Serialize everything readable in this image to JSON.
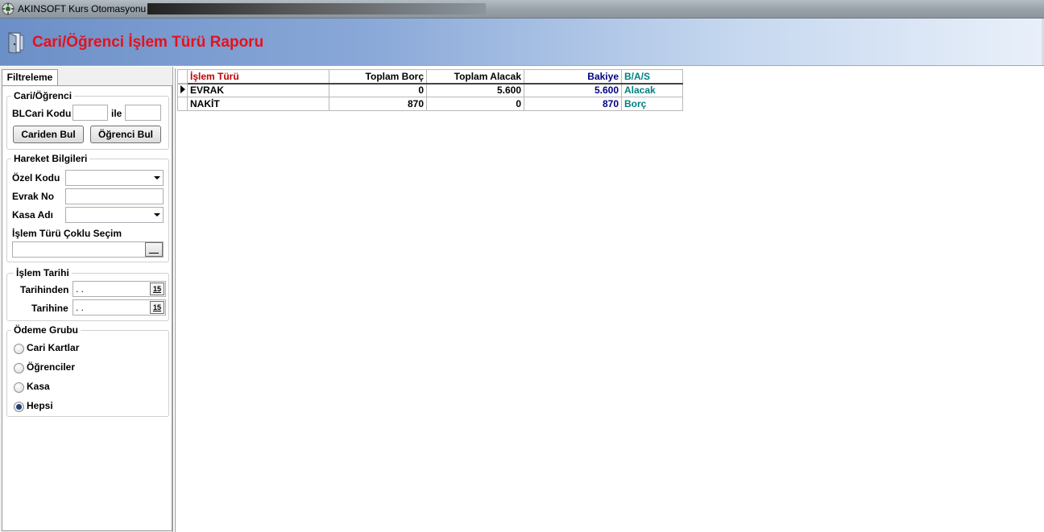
{
  "window": {
    "title": "AKINSOFT Kurs Otomasyonu s"
  },
  "header": {
    "title": "Cari/Öğrenci İşlem Türü Raporu"
  },
  "filter": {
    "tab_label": "Filtreleme",
    "cari_group": {
      "legend": "Cari/Öğrenci",
      "code_label": "BLCari Kodu",
      "code_from": "",
      "range_label": "ile",
      "code_to": "",
      "find_cari_button": "Cariden Bul",
      "find_student_button": "Öğrenci Bul"
    },
    "movement_group": {
      "legend": "Hareket Bilgileri",
      "special_code_label": "Özel Kodu",
      "special_code_value": "",
      "document_no_label": "Evrak No",
      "document_no_value": "",
      "cashbox_label": "Kasa Adı",
      "cashbox_value": "",
      "multi_select_label": "İşlem Türü Çoklu Seçim",
      "multi_select_value": ""
    },
    "date_group": {
      "legend": "İşlem Tarihi",
      "from_label": "Tarihinden",
      "from_value": " .  .",
      "to_label": "Tarihine",
      "to_value": " .  .",
      "calendar_glyph": "15"
    },
    "payment_group": {
      "legend": "Ödeme Grubu",
      "options": [
        {
          "label": "Cari Kartlar",
          "checked": false
        },
        {
          "label": "Öğrenciler",
          "checked": false
        },
        {
          "label": "Kasa",
          "checked": false
        },
        {
          "label": "Hepsi",
          "checked": true
        }
      ]
    }
  },
  "grid": {
    "columns": {
      "type": "İşlem Türü",
      "total_debit": "Toplam Borç",
      "total_credit": "Toplam Alacak",
      "balance": "Bakiye",
      "bas": "B/A/S"
    },
    "rows": [
      {
        "type": "EVRAK",
        "total_debit": "0",
        "total_credit": "5.600",
        "balance": "5.600",
        "bas": "Alacak",
        "current": true
      },
      {
        "type": "NAKİT",
        "total_debit": "870",
        "total_credit": "0",
        "balance": "870",
        "bas": "Borç",
        "current": false
      }
    ]
  },
  "colors": {
    "title_red": "#e8101a",
    "header_type_red": "#c00000",
    "balance_navy": "#000080",
    "bas_teal": "#008080"
  }
}
